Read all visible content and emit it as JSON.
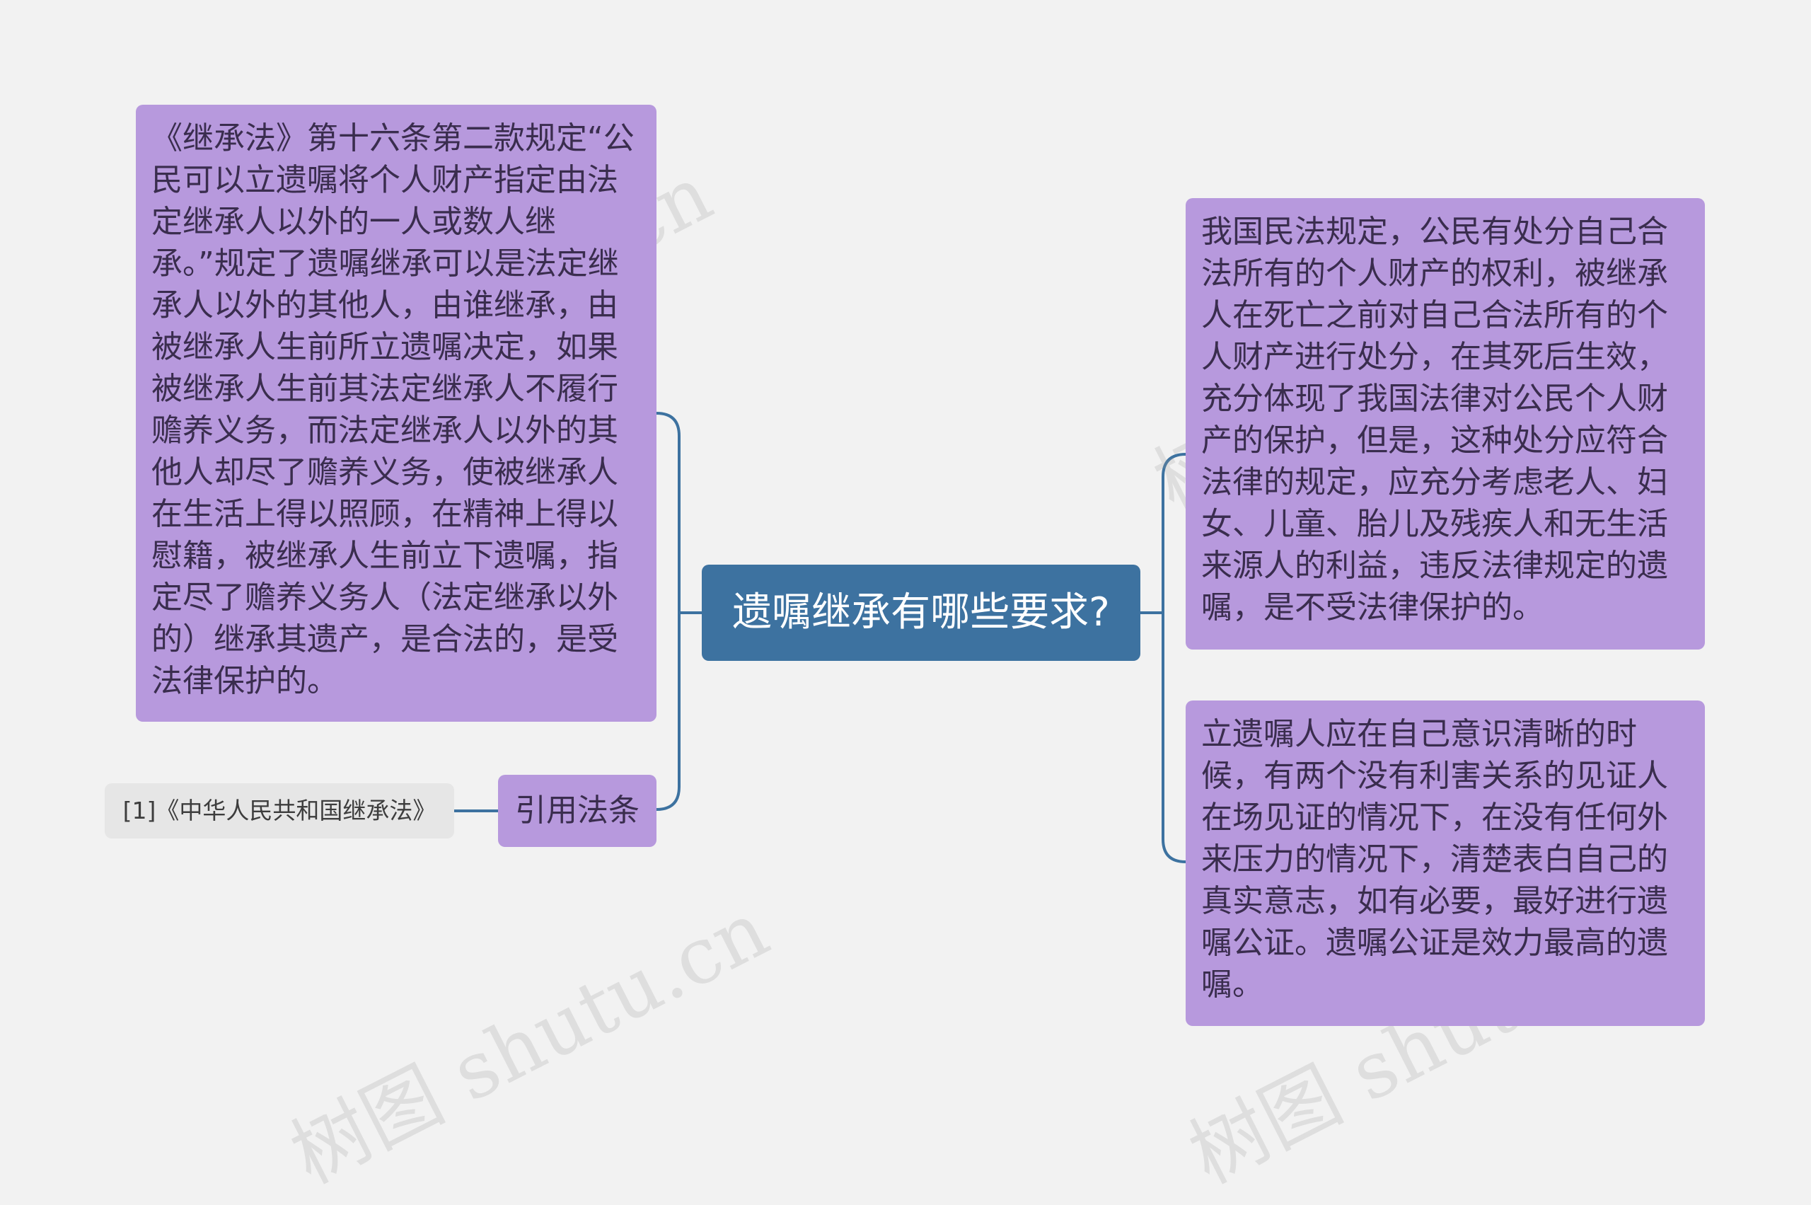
{
  "central": {
    "title": "遗嘱继承有哪些要求?"
  },
  "left": {
    "detail": "《继承法》第十六条第二款规定“公民可以立遗嘱将个人财产指定由法定继承人以外的一人或数人继承。”规定了遗嘱继承可以是法定继承人以外的其他人，由谁继承，由被继承人生前所立遗嘱决定，如果被继承人生前其法定继承人不履行赡养义务，而法定继承人以外的其他人却尽了赡养义务，使被继承人在生活上得以照顾，在精神上得以慰籍，被继承人生前立下遗嘱，指定尽了赡养义务人（法定继承以外的）继承其遗产，是合法的，是受法律保护的。",
    "citation_label": "引用法条",
    "citation_ref": "[1]《中华人民共和国继承法》"
  },
  "right": {
    "top": "我国民法规定，公民有处分自己合法所有的个人财产的权利，被继承人在死亡之前对自己合法所有的个人财产进行处分，在其死后生效，充分体现了我国法律对公民个人财产的保护，但是，这种处分应符合法律的规定，应充分考虑老人、妇女、儿童、胎儿及残疾人和无生活来源人的利益，违反法律规定的遗嘱，是不受法律保护的。",
    "bottom": "立遗嘱人应在自己意识清晰的时候，有两个没有利害关系的见证人在场见证的情况下，在没有任何外来压力的情况下，清楚表白自己的真实意志，如有必要，最好进行遗嘱公证。遗嘱公证是效力最高的遗嘱。"
  },
  "colors": {
    "background": "#f2f2f2",
    "central": "#3d72a0",
    "topic": "#b799dd",
    "reference": "#e6e6e6",
    "connector": "#3d72a0"
  }
}
